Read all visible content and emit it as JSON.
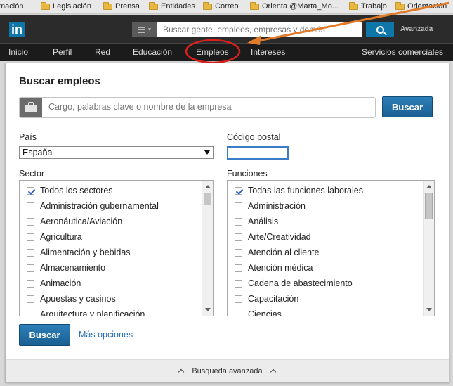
{
  "bookmarks": [
    {
      "label": "mación",
      "folder": false
    },
    {
      "label": "Legislación",
      "folder": true
    },
    {
      "label": "Prensa",
      "folder": true
    },
    {
      "label": "Entidades",
      "folder": true
    },
    {
      "label": "Correo",
      "folder": true
    },
    {
      "label": "Orienta @Marta_Mo...",
      "folder": true
    },
    {
      "label": "Trabajo",
      "folder": true
    },
    {
      "label": "Orientación",
      "folder": true
    }
  ],
  "header": {
    "logo_text": "in",
    "search_placeholder": "Buscar gente, empleos, empresas y demás",
    "advanced_label": "Avanzada"
  },
  "nav": {
    "items": [
      "Inicio",
      "Perfil",
      "Red",
      "Educación",
      "Empleos",
      "Intereses",
      "Servicios comerciales"
    ],
    "active": "Empleos"
  },
  "annotation": {
    "color": "#e07b2a",
    "circle_color": "#d9201c"
  },
  "job_search": {
    "title": "Buscar empleos",
    "placeholder": "Cargo, palabras clave o nombre de la empresa",
    "search_button": "Buscar"
  },
  "filters": {
    "country_label": "País",
    "country_value": "España",
    "postal_label": "Código postal",
    "postal_value": ""
  },
  "sector": {
    "label": "Sector",
    "items": [
      {
        "label": "Todos los sectores",
        "checked": true
      },
      {
        "label": "Administración gubernamental",
        "checked": false
      },
      {
        "label": "Aeronáutica/Aviación",
        "checked": false
      },
      {
        "label": "Agricultura",
        "checked": false
      },
      {
        "label": "Alimentación y bebidas",
        "checked": false
      },
      {
        "label": "Almacenamiento",
        "checked": false
      },
      {
        "label": "Animación",
        "checked": false
      },
      {
        "label": "Apuestas y casinos",
        "checked": false
      },
      {
        "label": "Arquitectura y planificación",
        "checked": false
      }
    ]
  },
  "functions": {
    "label": "Funciones",
    "items": [
      {
        "label": "Todas las funciones laborales",
        "checked": true
      },
      {
        "label": "Administración",
        "checked": false
      },
      {
        "label": "Análisis",
        "checked": false
      },
      {
        "label": "Arte/Creatividad",
        "checked": false
      },
      {
        "label": "Atención al cliente",
        "checked": false
      },
      {
        "label": "Atención médica",
        "checked": false
      },
      {
        "label": "Cadena de abastecimiento",
        "checked": false
      },
      {
        "label": "Capacitación",
        "checked": false
      },
      {
        "label": "Ciencias",
        "checked": false
      }
    ]
  },
  "actions": {
    "search_button": "Buscar",
    "more_options": "Más opciones"
  },
  "footer": {
    "advanced_search": "Búsqueda avanzada"
  }
}
